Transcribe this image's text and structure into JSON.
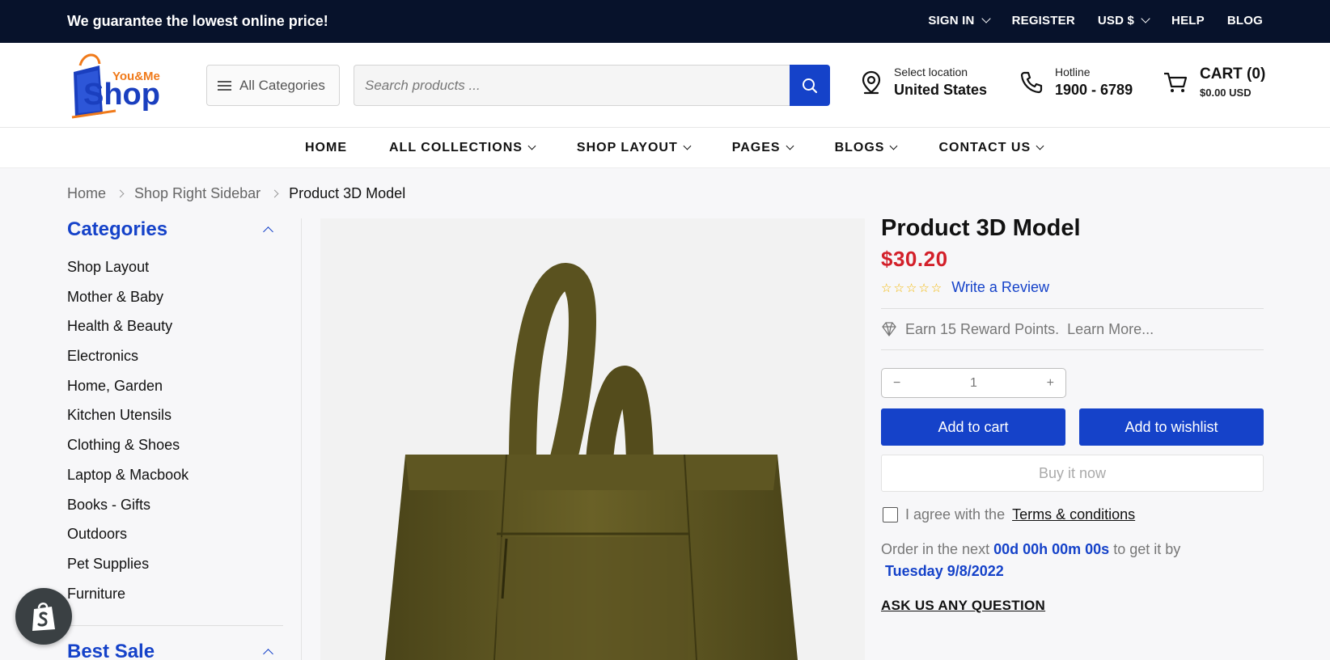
{
  "topbar": {
    "promo": "We guarantee the lowest online price!",
    "sign_in": "SIGN IN",
    "register": "REGISTER",
    "currency": "USD $",
    "help": "HELP",
    "blog": "BLOG"
  },
  "header": {
    "logo_small": "You&Me",
    "logo_big": "Shop",
    "all_categories": "All Categories",
    "search_placeholder": "Search products ...",
    "location_label": "Select location",
    "location_value": "United States",
    "hotline_label": "Hotline",
    "hotline_value": "1900 - 6789",
    "cart_label": "CART (0)",
    "cart_total": "$0.00 USD"
  },
  "nav": {
    "items": [
      "HOME",
      "ALL COLLECTIONS",
      "SHOP LAYOUT",
      "PAGES",
      "BLOGS",
      "CONTACT US"
    ]
  },
  "breadcrumb": {
    "home": "Home",
    "parent": "Shop Right Sidebar",
    "current": "Product 3D Model"
  },
  "sidebar": {
    "title": "Categories",
    "categories": [
      "Shop Layout",
      "Mother & Baby",
      "Health & Beauty",
      "Electronics",
      "Home, Garden",
      "Kitchen Utensils",
      "Clothing & Shoes",
      "Laptop & Macbook",
      "Books - Gifts",
      "Outdoors",
      "Pet Supplies",
      "Furniture"
    ],
    "best_sale": "Best Sale"
  },
  "product": {
    "title": "Product 3D Model",
    "price": "$30.20",
    "stars": "☆☆☆☆☆",
    "write_review": "Write a Review",
    "reward": "Earn 15 Reward Points.",
    "learn_more": "Learn More...",
    "qty_minus": "−",
    "qty_value": "1",
    "qty_plus": "+",
    "add_to_cart": "Add to cart",
    "add_to_wishlist": "Add to wishlist",
    "buy_now": "Buy it now",
    "agree_text": "I agree with the",
    "terms": "Terms & conditions",
    "order_prefix": "Order in the next",
    "countdown": "00d 00h 00m 00s",
    "order_mid": "to get it by",
    "delivery_date": "Tuesday 9/8/2022",
    "ask": "ASK US ANY QUESTION"
  },
  "colors": {
    "accent": "#1542c9",
    "topbar_bg": "#07122b",
    "price": "#d3202a",
    "star": "#f3b700"
  },
  "icons": [
    "chevron-down-icon",
    "menu-icon",
    "search-icon",
    "location-pin-icon",
    "phone-icon",
    "cart-icon",
    "chevron-right-icon",
    "chevron-up-icon",
    "star-icon",
    "diamond-icon",
    "shopify-icon"
  ]
}
